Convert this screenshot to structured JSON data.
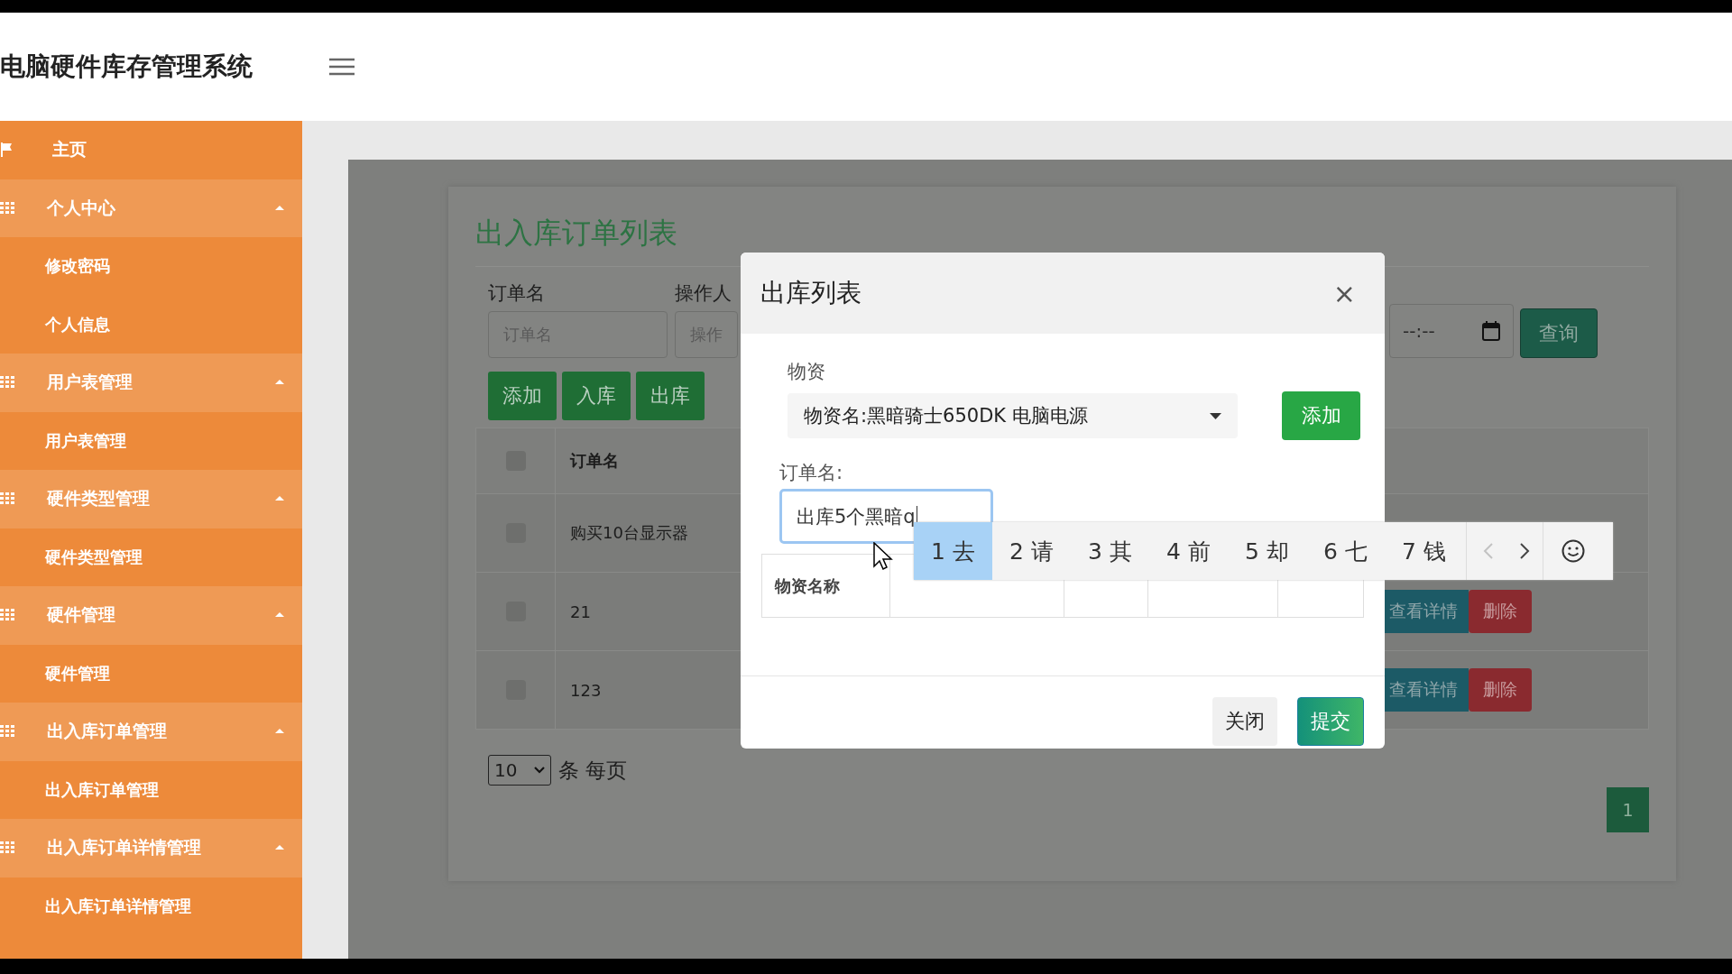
{
  "header": {
    "title": "电脑硬件库存管理系统"
  },
  "sidebar": {
    "items": [
      {
        "label": "主页",
        "kind": "home"
      },
      {
        "label": "个人中心",
        "kind": "group",
        "expanded": true,
        "children": [
          {
            "label": "修改密码"
          },
          {
            "label": "个人信息"
          }
        ]
      },
      {
        "label": "用户表管理",
        "kind": "group",
        "expanded": true,
        "children": [
          {
            "label": "用户表管理"
          }
        ]
      },
      {
        "label": "硬件类型管理",
        "kind": "group",
        "expanded": true,
        "children": [
          {
            "label": "硬件类型管理"
          }
        ]
      },
      {
        "label": "硬件管理",
        "kind": "group",
        "expanded": true,
        "children": [
          {
            "label": "硬件管理"
          }
        ]
      },
      {
        "label": "出入库订单管理",
        "kind": "group",
        "expanded": true,
        "children": [
          {
            "label": "出入库订单管理"
          }
        ]
      },
      {
        "label": "出入库订单详情管理",
        "kind": "group",
        "expanded": true,
        "children": [
          {
            "label": "出入库订单详情管理"
          }
        ]
      }
    ]
  },
  "page": {
    "title": "出入库订单列表",
    "search": [
      {
        "label": "订单名",
        "placeholder": "订单名"
      },
      {
        "label": "操作人",
        "placeholder": "操作"
      }
    ],
    "date_field": {
      "value": "--:--"
    },
    "search_button": "查询",
    "buttons": [
      {
        "label": "添加"
      },
      {
        "label": "入库"
      },
      {
        "label": "出库"
      }
    ],
    "table": {
      "select_all_checked": false,
      "columns": [
        "订单名"
      ],
      "rows": [
        {
          "checked": false,
          "name": "购买10台显示器"
        },
        {
          "checked": false,
          "name": "21",
          "actions": [
            {
              "label": "查看详情",
              "kind": "view"
            },
            {
              "label": "删除",
              "kind": "delete"
            }
          ]
        },
        {
          "checked": false,
          "name": "123",
          "actions": [
            {
              "label": "查看详情",
              "kind": "view"
            },
            {
              "label": "删除",
              "kind": "delete"
            }
          ]
        }
      ]
    },
    "page_size": "10",
    "page_size_label": "条 每页",
    "pagination": [
      {
        "label": "1",
        "selected": true
      }
    ]
  },
  "modal": {
    "title": "出库列表",
    "close": "×",
    "material_label": "物资",
    "material_value": "物资名:黑暗骑士650DK 电脑电源",
    "add_button": "添加",
    "order_label": "订单名:",
    "order_value": "出库5个黑暗q",
    "columns": [
      "物资名称"
    ],
    "buttons": [
      {
        "label": "关闭",
        "kind": "secondary"
      },
      {
        "label": "提交",
        "kind": "primary"
      }
    ]
  },
  "ime": {
    "candidates": [
      {
        "label": "1 去",
        "selected": true
      },
      {
        "label": "2 请",
        "selected": false
      },
      {
        "label": "3 其",
        "selected": false
      },
      {
        "label": "4 前",
        "selected": false
      },
      {
        "label": "5 却",
        "selected": false
      },
      {
        "label": "6 七",
        "selected": false
      },
      {
        "label": "7 钱",
        "selected": false
      }
    ],
    "prev_disabled": true
  }
}
